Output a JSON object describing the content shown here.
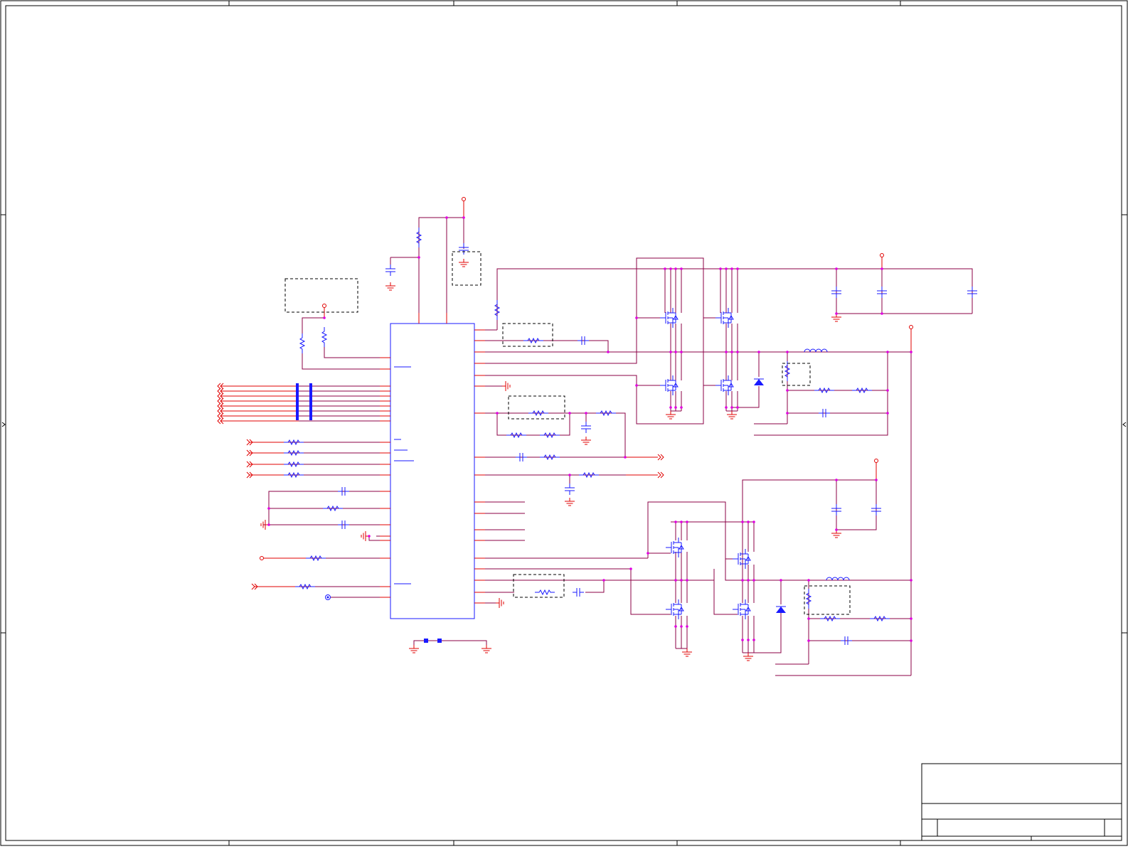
{
  "colors": {
    "wire": "#8b0046",
    "net": "#e00000",
    "component": "#1a1aff",
    "junction": "#e000e0",
    "frame": "#000000",
    "dashed": "#000000"
  },
  "title_block": {
    "title": "",
    "size": "",
    "sheet": ""
  },
  "icons": [
    "resistor-icon",
    "capacitor-icon",
    "inductor-icon",
    "mosfet-icon",
    "diode-icon",
    "ground-icon",
    "power-icon",
    "off-page-connector-icon",
    "test-point-icon"
  ]
}
